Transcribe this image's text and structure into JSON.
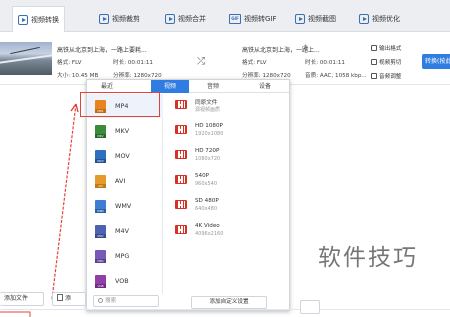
{
  "tabs": [
    {
      "label": "视频转换",
      "active": true
    },
    {
      "label": "视频裁剪",
      "active": false
    },
    {
      "label": "视频合并",
      "active": false
    },
    {
      "label": "视频转GIF",
      "active": false
    },
    {
      "label": "视频截图",
      "active": false
    },
    {
      "label": "视频优化",
      "active": false
    }
  ],
  "file": {
    "source_name": "高铁从北京到上海，一路上要耗...",
    "source_format": "格式: FLV",
    "source_duration": "时长: 00:01:11",
    "source_size": "大小: 10.45 MB",
    "source_resolution": "分辨率: 1280x720",
    "target_name": "高铁从北京到上海，一路上...",
    "target_format": "格式: FLV",
    "target_duration": "时长: 00:01:11",
    "target_resolution": "分辨率: 1280x720",
    "target_audio": "音质: AAC, 1058 kbp...",
    "output_format_label": "输出格式",
    "video_clip_label": "视频剪切",
    "audio_adjust_label": "音频调整",
    "convert_button": "转换(按此"
  },
  "popup": {
    "tabs": [
      {
        "label": "最近",
        "active": false
      },
      {
        "label": "视频",
        "active": true
      },
      {
        "label": "音频",
        "active": false
      },
      {
        "label": "设备",
        "active": false
      }
    ],
    "formats": [
      {
        "name": "MP4",
        "color": "#e8841f",
        "selected": true
      },
      {
        "name": "MKV",
        "color": "#3c8a3c"
      },
      {
        "name": "MOV",
        "color": "#2f6fbf"
      },
      {
        "name": "AVI",
        "color": "#e69a2a"
      },
      {
        "name": "WMV",
        "color": "#3d7ed4"
      },
      {
        "name": "M4V",
        "color": "#4e63b0"
      },
      {
        "name": "MPG",
        "color": "#7a58b5"
      },
      {
        "name": "VOB",
        "color": "#8f3fa8"
      }
    ],
    "qualities": [
      {
        "name": "同原文件",
        "desc": "源视频画质"
      },
      {
        "name": "HD 1080P",
        "desc": "1920x1080"
      },
      {
        "name": "HD 720P",
        "desc": "1080x720"
      },
      {
        "name": "540P",
        "desc": "960x540"
      },
      {
        "name": "SD 480P",
        "desc": "640x480"
      },
      {
        "name": "4K Video",
        "desc": "4096x2160"
      }
    ],
    "search_placeholder": "搜索",
    "custom_button": "添加自定义设置"
  },
  "bottom": {
    "add_file": "添加文件",
    "add_folder": "添"
  },
  "watermark": "软件技巧",
  "accent_color": "#2f7de1",
  "highlight_color": "#e0453c"
}
